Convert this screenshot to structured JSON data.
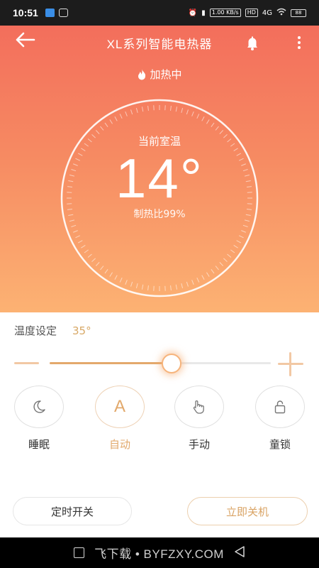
{
  "status_bar": {
    "time": "10:51",
    "net_speed": "1.00 KB/s",
    "hd_label": "HD",
    "network": "4G",
    "battery": "88"
  },
  "header": {
    "title": "XL系列智能电热器",
    "back_icon": "arrow-left-icon",
    "bell_icon": "bell-icon",
    "more_icon": "more-vertical-icon"
  },
  "status": {
    "text": "加热中",
    "icon": "flame-icon"
  },
  "dial": {
    "label": "当前室温",
    "temperature": "14°",
    "heat_ratio": "制热比99%"
  },
  "setting": {
    "label": "温度设定",
    "value": "35°",
    "slider_fraction": 0.55
  },
  "modes": [
    {
      "label": "睡眠",
      "icon": "moon-icon",
      "active": false
    },
    {
      "label": "自动",
      "icon": "auto-icon",
      "letter": "A",
      "active": true
    },
    {
      "label": "手动",
      "icon": "hand-icon",
      "active": false
    },
    {
      "label": "童锁",
      "icon": "lock-icon",
      "active": false
    }
  ],
  "actions": {
    "timer": "定时开关",
    "shutdown": "立即关机"
  },
  "nav": {
    "watermark": "飞下载 • BYFZXY.COM"
  },
  "colors": {
    "accent": "#e2a96c",
    "hero_top": "#f36e5c",
    "hero_bottom": "#fcb273"
  }
}
